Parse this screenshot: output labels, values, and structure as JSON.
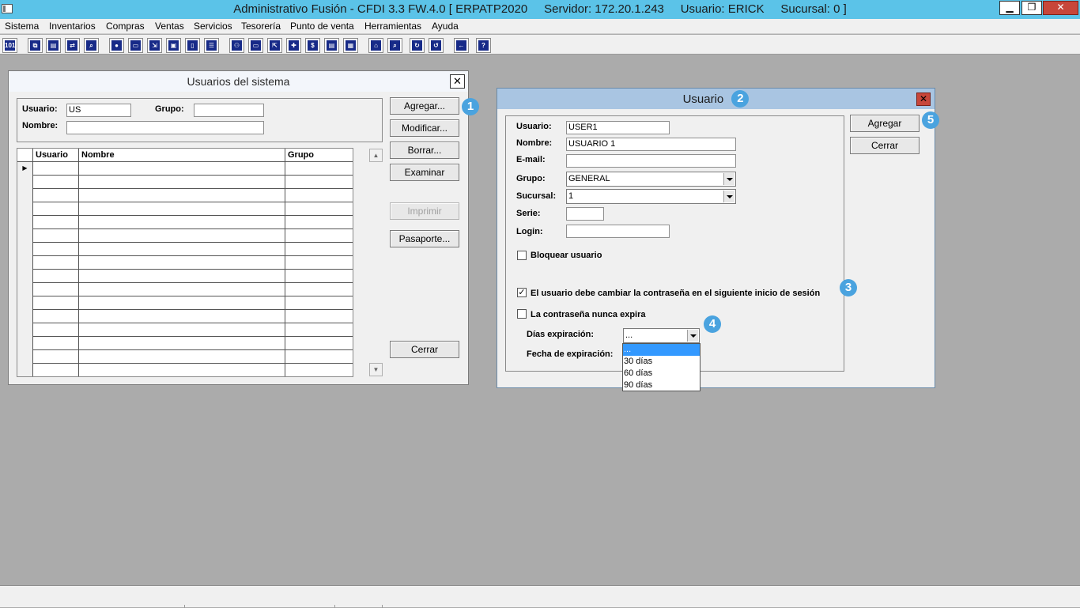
{
  "app": {
    "title": "Administrativo Fusión - CFDI 3.3 FW.4.0 [ ERPATP2020     Servidor: 172.20.1.243     Usuario: ERICK     Sucursal: 0 ]",
    "window_buttons": {
      "minimize": "▁",
      "maximize": "❐",
      "close": "✕"
    }
  },
  "menu": [
    "Sistema",
    "Inventarios",
    "Compras",
    "Ventas",
    "Servicios",
    "Tesorería",
    "Punto de venta",
    "Herramientas",
    "Ayuda"
  ],
  "toolbar_icons": [
    "calculator-icon",
    "copy-icon",
    "clipboard-icon",
    "swap-icon",
    "search-doc-icon",
    "user-icon",
    "folder-icon",
    "export-icon",
    "print-icon",
    "document-icon",
    "list-icon",
    "users-icon",
    "folder-open-icon",
    "import-icon",
    "add-icon",
    "dollar-icon",
    "report-icon",
    "table-icon",
    "home-icon",
    "find-icon",
    "refresh-icon",
    "undo-icon",
    "back-icon",
    "help-icon"
  ],
  "usuarios_window": {
    "title": "Usuarios del sistema",
    "close": "✕",
    "filters": {
      "usuario_label": "Usuario:",
      "usuario_value": "US",
      "grupo_label": "Grupo:",
      "grupo_value": "",
      "nombre_label": "Nombre:",
      "nombre_value": ""
    },
    "columns": [
      "Usuario",
      "Nombre",
      "Grupo"
    ],
    "current_row_marker": "▶",
    "buttons": {
      "agregar": "Agregar...",
      "modificar": "Modificar...",
      "borrar": "Borrar...",
      "examinar": "Examinar",
      "imprimir": "Imprimir",
      "pasaporte": "Pasaporte...",
      "cerrar": "Cerrar"
    }
  },
  "usuario_dialog": {
    "title": "Usuario",
    "close": "✕",
    "fields": {
      "usuario_label": "Usuario:",
      "usuario_value": "USER1",
      "nombre_label": "Nombre:",
      "nombre_value": "USUARIO 1",
      "email_label": "E-mail:",
      "email_value": "",
      "grupo_label": "Grupo:",
      "grupo_value": "GENERAL",
      "sucursal_label": "Sucursal:",
      "sucursal_value": "1",
      "serie_label": "Serie:",
      "serie_value": "",
      "login_label": "Login:",
      "login_value": ""
    },
    "checkboxes": {
      "bloquear": {
        "label": "Bloquear usuario",
        "checked": false
      },
      "cambiar_contrasena": {
        "label": "El usuario debe cambiar la contraseña en el siguiente inicio de sesión",
        "checked": true
      },
      "nunca_expira": {
        "label": "La contraseña nunca expira",
        "checked": false
      }
    },
    "check_mark": "✓",
    "dias_label": "Días expiración:",
    "dias_value": "...",
    "dias_options": [
      "...",
      "30 días",
      "60 días",
      "90  días"
    ],
    "fecha_label": "Fecha de expiración:",
    "buttons": {
      "agregar": "Agregar",
      "cerrar": "Cerrar"
    }
  },
  "badges": [
    "1",
    "2",
    "3",
    "4",
    "5"
  ],
  "colors": {
    "titlebar": "#5bc3e8",
    "dialog_titlebar": "#a9c5e2",
    "badge": "#4aa3df",
    "selection": "#3399ff",
    "close_red": "#c7463a"
  }
}
